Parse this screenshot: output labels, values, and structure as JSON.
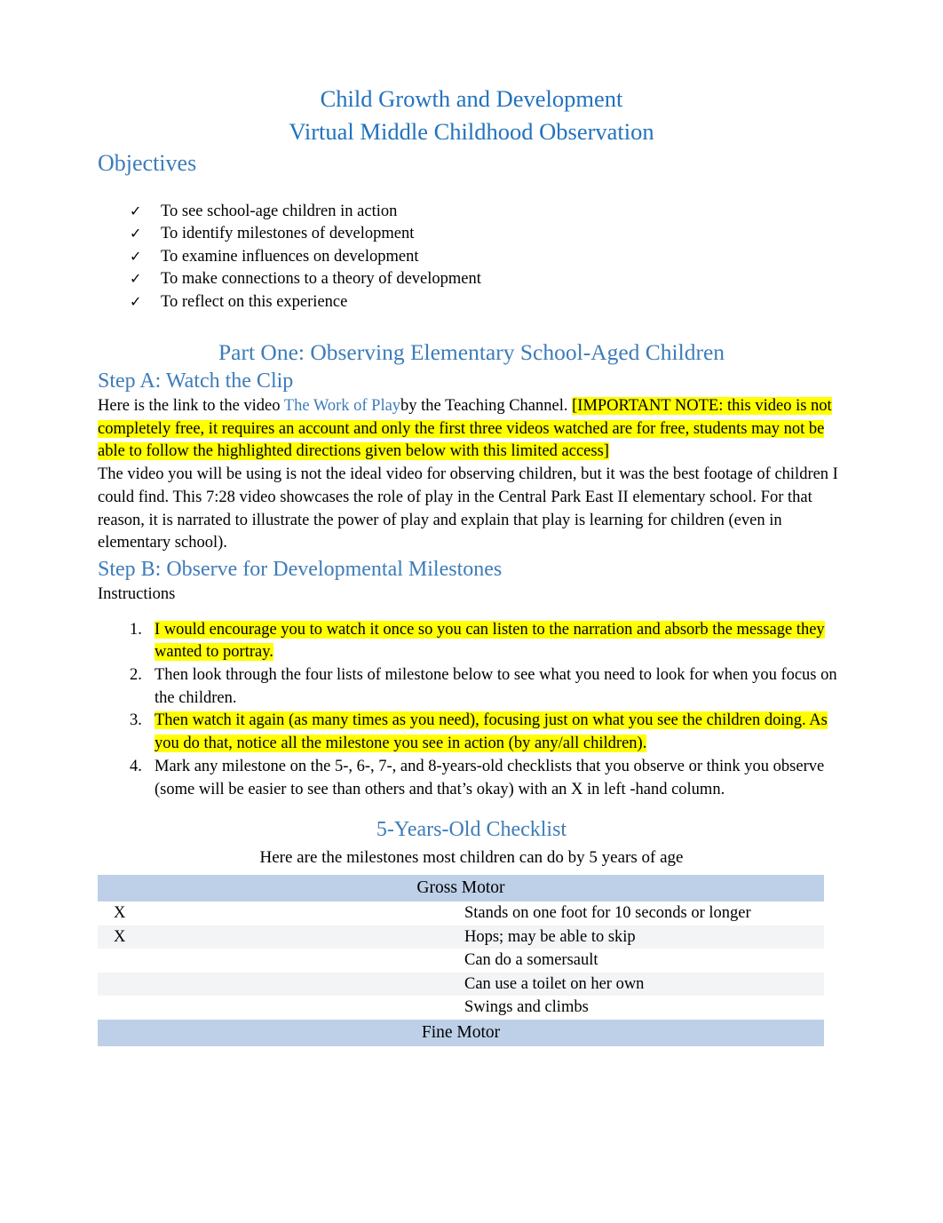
{
  "document": {
    "title_line1": "Child Growth and Development",
    "title_line2": "Virtual Middle Childhood Observation",
    "title_color": "#2272bd",
    "heading_color": "#3d7cb8",
    "highlight_color": "#ffff00",
    "table_header_color": "#bdd0e8"
  },
  "objectives": {
    "heading": "Objectives",
    "bullet_glyph": "✓",
    "items": [
      "To see school-age children in action",
      "To identify milestones of development",
      "To examine influences on development",
      "To make connections to a theory of development",
      "To reflect on this experience"
    ]
  },
  "part_one": {
    "heading": "Part One: Observing Elementary School-Aged Children"
  },
  "step_a": {
    "heading": "Step A: Watch the Clip",
    "paragraph_prefix": "Here is the link to the video ",
    "link_text": "The Work of Play",
    "paragraph_mid": "by the Teaching Channel. ",
    "paragraph_highlighted": "[IMPORTANT NOTE: this video is not completely free, it requires an account and only the first three videos watched are for free, students may not be able to follow the highlighted directions given below with this limited access]",
    "paragraph_video": "The video you will be using is not the ideal video for observing children, but it was the best footage of children I could find. This 7:28 video showcases the role of play in the Central Park East II elementary school. For that reason, it is narrated to illustrate the power of play and explain that play is learning for children (even in elementary school)."
  },
  "step_b": {
    "heading": "Step B: Observe for Developmental Milestones",
    "instructions_label": "Instructions",
    "instructions": [
      {
        "number": "1.",
        "text": "I would encourage you to watch it once so you can listen to the narration and absorb the message they wanted to portray.",
        "highlighted": true
      },
      {
        "number": "2.",
        "text": "Then look through the four lists of milestone below to see what you need to look for when you focus on the children.",
        "highlighted": false
      },
      {
        "number": "3.",
        "text": "Then watch it again (as many times as you need), focusing just on what you see the children doing. As you do that, notice all the milestone you see in action (by any/all children).",
        "highlighted": true
      },
      {
        "number": "4.",
        "text": "Mark any milestone on the 5-, 6-, 7-, and 8-years-old checklists that you observe or think you observe (some will be easier to see than others and that’s okay) with an X in left -hand column.",
        "highlighted": false
      }
    ]
  },
  "checklist": {
    "title": "5-Years-Old Checklist",
    "subtitle": "Here are the milestones most children can do by 5 years of age",
    "sections": [
      {
        "category": "Gross Motor",
        "rows": [
          {
            "mark": "X",
            "description": "Stands on one foot for 10 seconds or longer"
          },
          {
            "mark": "X",
            "description": "Hops; may be able to skip"
          },
          {
            "mark": "",
            "description": "Can do a somersault"
          },
          {
            "mark": "",
            "description": "Can use a toilet on her own"
          },
          {
            "mark": "",
            "description": "Swings and climbs"
          }
        ]
      },
      {
        "category": "Fine Motor",
        "rows": []
      }
    ]
  }
}
